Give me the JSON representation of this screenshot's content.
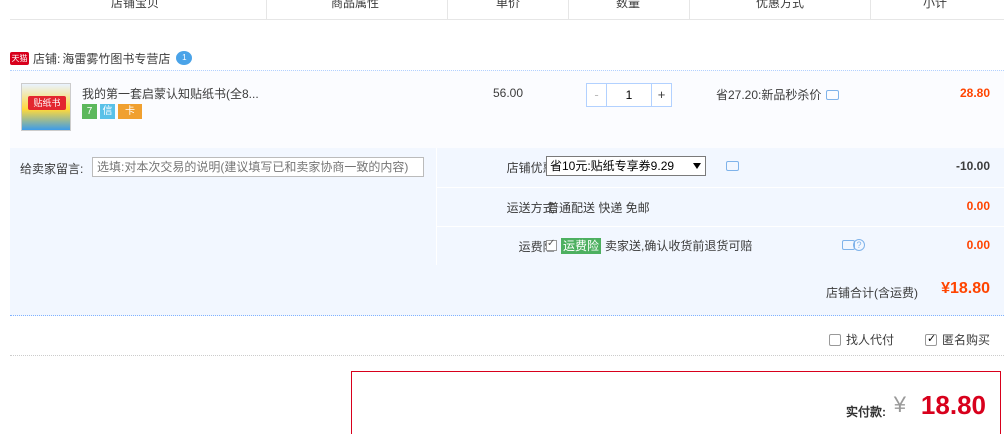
{
  "header": {
    "columns": [
      "店铺宝贝",
      "商品属性",
      "单价",
      "数量",
      "优惠方式",
      "小计"
    ]
  },
  "shop": {
    "badge": "天猫",
    "label": "店铺:",
    "name": "海雷雾竹图书专营店",
    "chat_icon": "wangwang-icon"
  },
  "item": {
    "thumb_text": "贴纸书",
    "title": "我的第一套启蒙认知贴纸书(全8...",
    "badges": [
      "7",
      "信",
      "卡"
    ],
    "price": "56.00",
    "quantity": "1",
    "minus": "-",
    "plus": "+",
    "promo": "省27.20:新品秒杀价",
    "subtotal": "28.80"
  },
  "message": {
    "label": "给卖家留言:",
    "placeholder": "选填:对本次交易的说明(建议填写已和卖家协商一致的内容)"
  },
  "coupon": {
    "label": "店铺优惠:",
    "selected": "省10元:贴纸专享券9.29",
    "amount": "-10.00"
  },
  "shipping": {
    "label": "运送方式:",
    "method": "普通配送 快递 免邮",
    "amount": "0.00"
  },
  "insurance": {
    "label": "运费险:",
    "tag": "运费险",
    "text": "卖家送,确认收货前退货可赔",
    "amount": "0.00"
  },
  "shop_total": {
    "label": "店铺合计(含运费)",
    "value": "¥18.80"
  },
  "options": {
    "proxy_pay": "找人代付",
    "anonymous": "匿名购买"
  },
  "payment": {
    "label": "实付款:",
    "currency": "¥",
    "value": "18.80"
  },
  "colors": {
    "accent": "#ff4400",
    "brand_red": "#d8001c",
    "panel_blue": "#f2f7ff"
  }
}
